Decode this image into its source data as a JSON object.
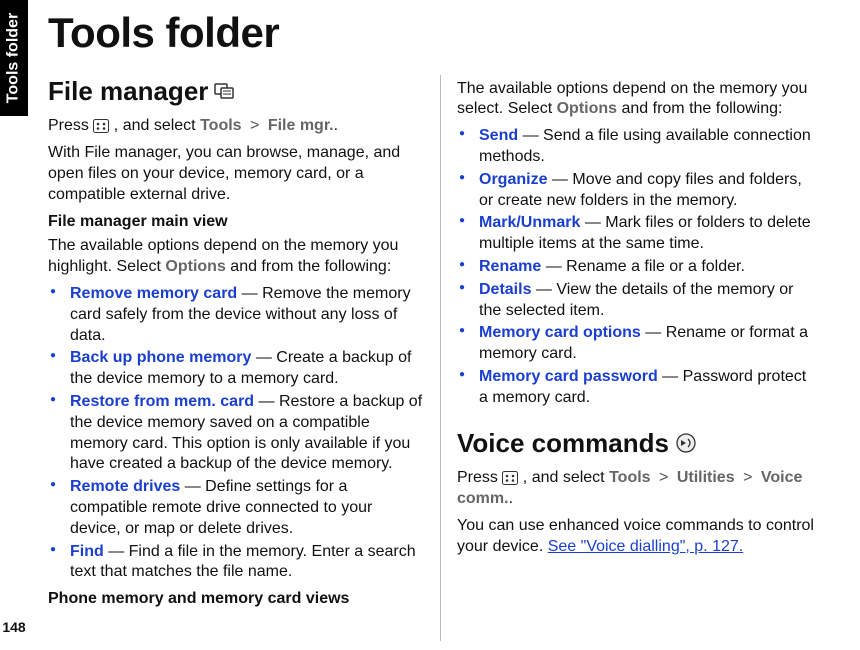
{
  "sideTab": "Tools folder",
  "pageNumber": "148",
  "title": "Tools folder",
  "left": {
    "h2": "File manager",
    "pressPrefix": "Press ",
    "pressMid": ", and select ",
    "navTools": "Tools",
    "navFileMgr": "File mgr.",
    "navEnd": ".",
    "intro": "With File manager, you can browse, manage, and open files on your device, memory card, or a compatible external drive.",
    "h3a": "File manager main view",
    "leadA": "The available options depend on the memory you highlight. Select ",
    "leadAOptions": "Options",
    "leadAEnd": " and from the following:",
    "items": [
      {
        "term": "Remove memory card",
        "desc": " — Remove the memory card safely from the device without any loss of data."
      },
      {
        "term": "Back up phone memory",
        "desc": " — Create a backup of the device memory to a memory card."
      },
      {
        "term": "Restore from mem. card",
        "desc": " — Restore a backup of the device memory saved on a compatible memory card. This option is only available if you have created a backup of the device memory."
      },
      {
        "term": "Remote drives",
        "desc": " — Define settings for a compatible remote drive connected to your device, or map or delete drives."
      },
      {
        "term": "Find",
        "desc": " — Find a file in the memory. Enter a search text that matches the file name."
      }
    ],
    "h3b": "Phone memory and memory card views"
  },
  "right": {
    "leadB": "The available options depend on the memory you select. Select ",
    "leadBOptions": "Options",
    "leadBEnd": " and from the following:",
    "items": [
      {
        "term": "Send",
        "desc": " — Send a file using available connection methods."
      },
      {
        "term": "Organize",
        "desc": " — Move and copy files and folders, or create new folders in the memory."
      },
      {
        "term": "Mark/Unmark",
        "desc": " — Mark files or folders to delete multiple items at the same time."
      },
      {
        "term": "Rename",
        "desc": " — Rename a file or a folder."
      },
      {
        "term": "Details",
        "desc": " — View the details of the memory or the selected item."
      },
      {
        "term": "Memory card options",
        "desc": " — Rename or format a memory card."
      },
      {
        "term": "Memory card password",
        "desc": " — Password protect a memory card."
      }
    ],
    "h2": "Voice commands",
    "pressPrefix": "Press ",
    "pressMid": ", and select ",
    "navTools": "Tools",
    "navUtil": "Utilities",
    "navVoice": "Voice comm.",
    "navEnd": ".",
    "intro2": "You can use enhanced voice commands to control your device. ",
    "linkText": "See \"Voice dialling\", p. 127."
  }
}
